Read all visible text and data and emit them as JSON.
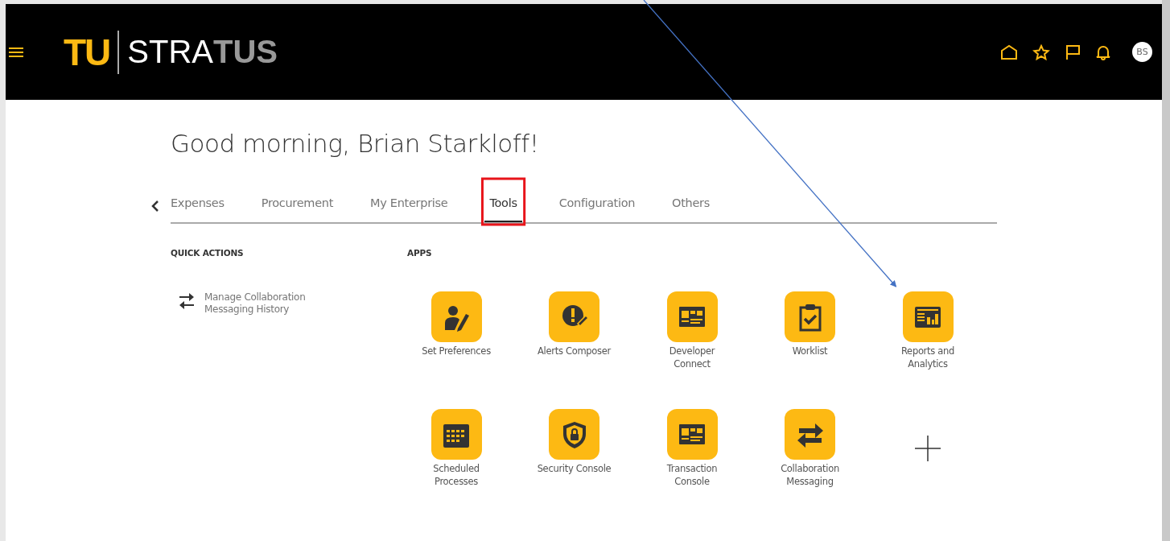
{
  "logo": {
    "mark": "TU",
    "name_light": "STRA",
    "name_dark": "TUS"
  },
  "header": {
    "avatar": "BS"
  },
  "greeting": "Good morning, Brian Starkloff!",
  "tabs": [
    {
      "label": "Expenses",
      "selected": false,
      "boxed": false
    },
    {
      "label": "Procurement",
      "selected": false,
      "boxed": false
    },
    {
      "label": "My Enterprise",
      "selected": false,
      "boxed": false
    },
    {
      "label": "Tools",
      "selected": true,
      "boxed": true
    },
    {
      "label": "Configuration",
      "selected": false,
      "boxed": false
    },
    {
      "label": "Others",
      "selected": false,
      "boxed": false
    }
  ],
  "quick_actions": {
    "heading": "QUICK ACTIONS",
    "items": [
      {
        "label": "Manage Collaboration Messaging History"
      }
    ]
  },
  "apps": {
    "heading": "APPS",
    "items": [
      {
        "label": "Set Preferences",
        "pointed": false
      },
      {
        "label": "Alerts Composer",
        "pointed": false
      },
      {
        "label": "Developer Connect",
        "pointed": false
      },
      {
        "label": "Worklist",
        "pointed": false
      },
      {
        "label": "Reports and Analytics",
        "pointed": true
      },
      {
        "label": "Scheduled Processes",
        "pointed": false
      },
      {
        "label": "Security Console",
        "pointed": false
      },
      {
        "label": "Transaction Console",
        "pointed": false
      },
      {
        "label": "Collaboration Messaging",
        "pointed": false
      }
    ]
  }
}
